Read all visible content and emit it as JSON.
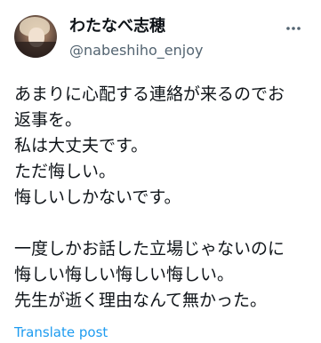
{
  "author": {
    "display_name": "わたなべ志穂",
    "handle": "@nabeshiho_enjoy",
    "more_icon": "ellipsis-icon"
  },
  "tweet": {
    "lines": [
      "あまりに心配する連絡が来るのでお",
      "返事を。",
      "私は大丈夫です。",
      "ただ悔しい。",
      "悔しいしかないです。",
      "",
      "一度しかお話した立場じゃないのに",
      "悔しい悔しい悔しい悔しい。",
      "先生が逝く理由なんて無かった。"
    ]
  },
  "actions": {
    "translate_label": "Translate post"
  },
  "colors": {
    "text": "#0f1419",
    "secondary": "#536471",
    "accent": "#1d9bf0"
  }
}
